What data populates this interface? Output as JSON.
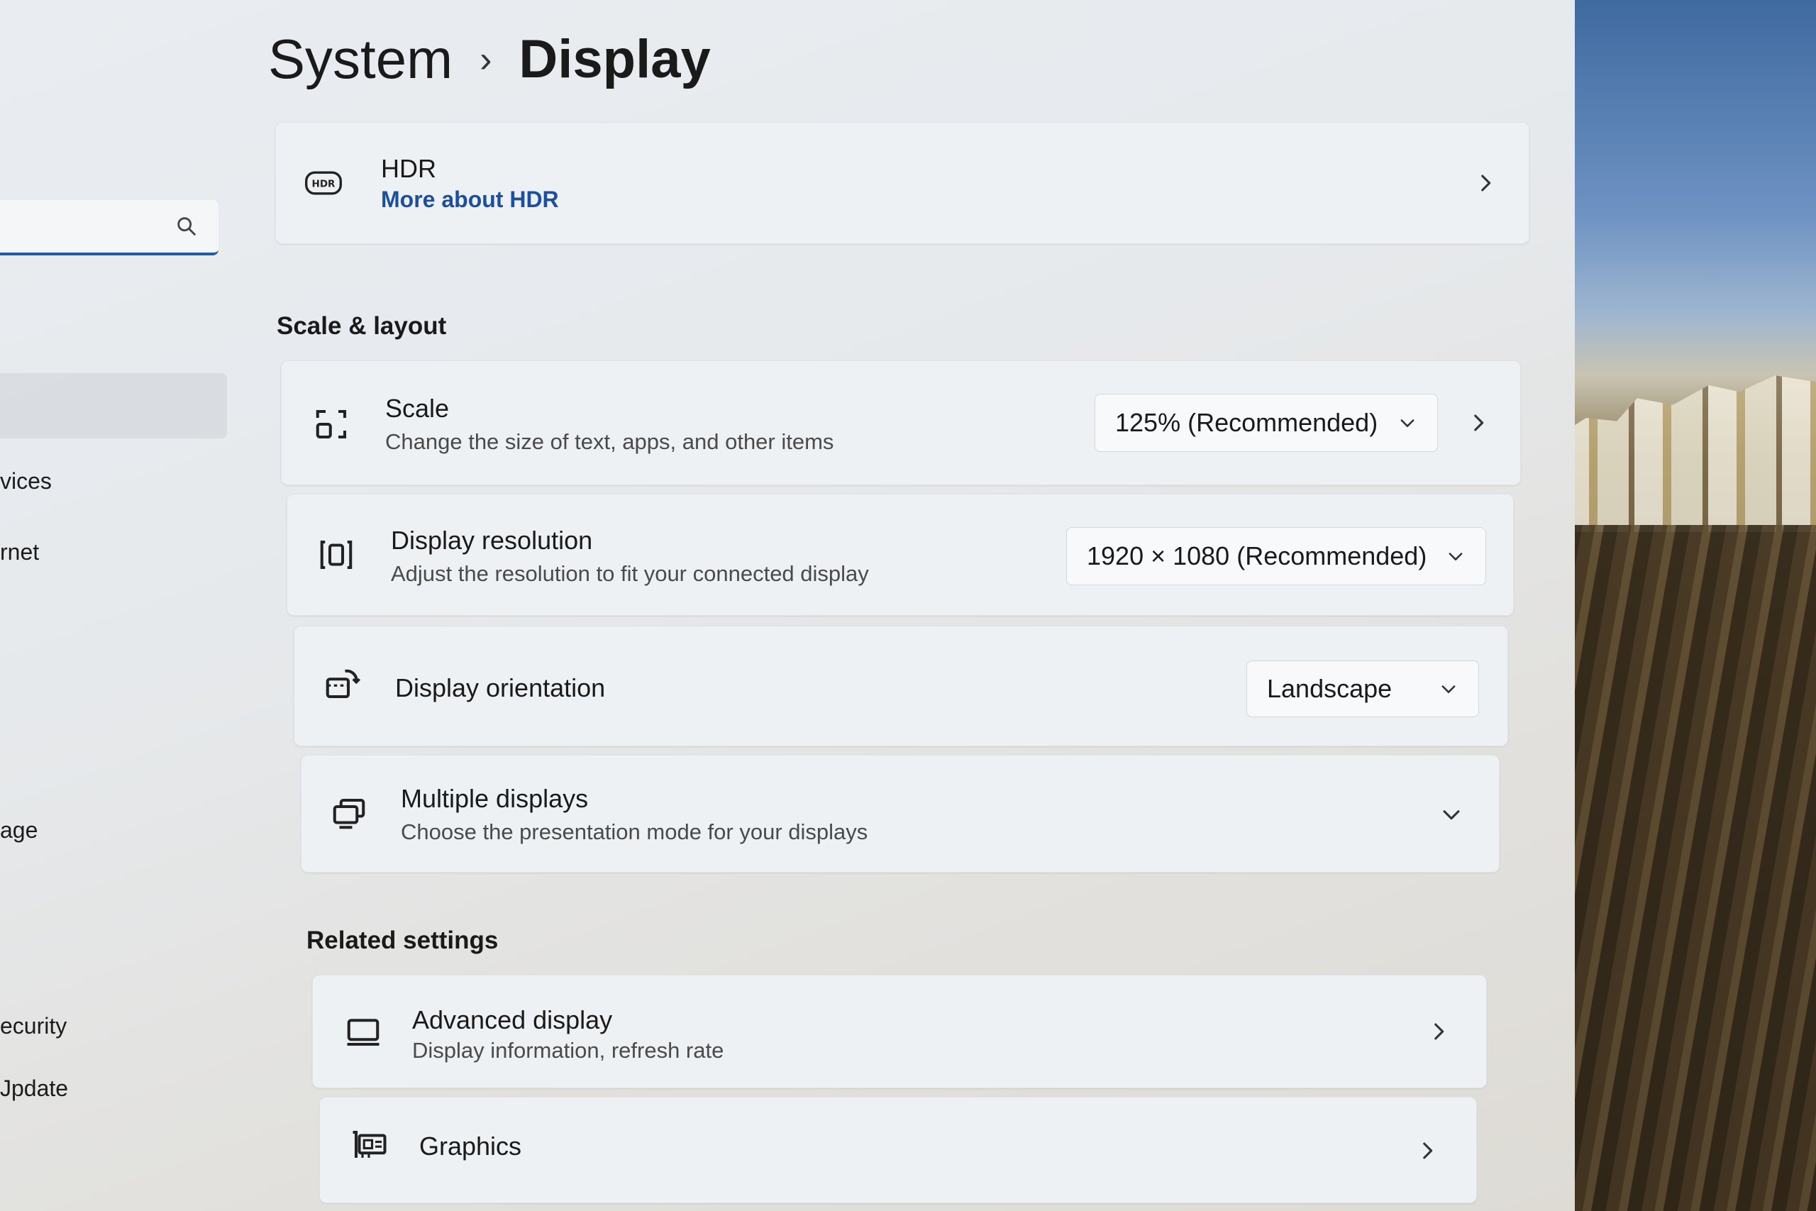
{
  "breadcrumb": {
    "parent": "System",
    "separator": "›",
    "current": "Display"
  },
  "sidebar": {
    "items": [
      {
        "label": "vices"
      },
      {
        "label": "rnet"
      },
      {
        "label": "age"
      },
      {
        "label": "ecurity"
      },
      {
        "label": "Jpdate"
      }
    ]
  },
  "hdr": {
    "title": "HDR",
    "link": "More about HDR",
    "icon": "hdr-icon"
  },
  "sections": {
    "scale_layout": "Scale & layout",
    "related": "Related settings"
  },
  "scale": {
    "title": "Scale",
    "subtitle": "Change the size of text, apps, and other items",
    "value": "125% (Recommended)",
    "icon": "scale-icon"
  },
  "resolution": {
    "title": "Display resolution",
    "subtitle": "Adjust the resolution to fit your connected display",
    "value": "1920 × 1080 (Recommended)",
    "icon": "resolution-icon"
  },
  "orientation": {
    "title": "Display orientation",
    "value": "Landscape",
    "icon": "rotate-icon"
  },
  "multiple": {
    "title": "Multiple displays",
    "subtitle": "Choose the presentation mode for your displays",
    "icon": "multiple-displays-icon"
  },
  "advanced": {
    "title": "Advanced display",
    "subtitle": "Display information, refresh rate",
    "icon": "monitor-icon"
  },
  "graphics": {
    "title": "Graphics",
    "icon": "graphics-card-icon"
  },
  "colors": {
    "accent": "#1d5ca8",
    "link": "#1b4fa0"
  }
}
